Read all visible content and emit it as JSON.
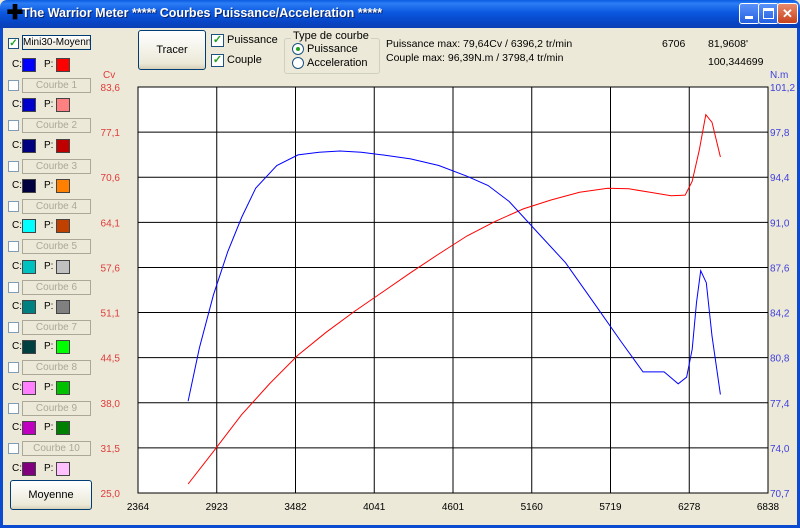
{
  "window": {
    "title": "The Warrior Meter ***** Courbes Puissance/Acceleration *****"
  },
  "sidebar": {
    "top_checked": true,
    "top_button": "Mini30-Moyenne",
    "rows": [
      {
        "label": "Courbe 1",
        "c_color": "#0000ff",
        "p_color": "#ff0000"
      },
      {
        "label": "Courbe 2",
        "c_color": "#0000cd",
        "p_color": "#ff8080"
      },
      {
        "label": "Courbe 3",
        "c_color": "#000080",
        "p_color": "#c00000"
      },
      {
        "label": "Courbe 4",
        "c_color": "#000040",
        "p_color": "#ff8000"
      },
      {
        "label": "Courbe 5",
        "c_color": "#00ffff",
        "p_color": "#c04000"
      },
      {
        "label": "Courbe 6",
        "c_color": "#00c0c0",
        "p_color": "#c0c0c0"
      },
      {
        "label": "Courbe 7",
        "c_color": "#008080",
        "p_color": "#808080"
      },
      {
        "label": "Courbe 8",
        "c_color": "#004040",
        "p_color": "#00ff00"
      },
      {
        "label": "Courbe 9",
        "c_color": "#ff80ff",
        "p_color": "#00c000"
      },
      {
        "label": "Courbe 10",
        "c_color": "#c000c0",
        "p_color": "#008000"
      },
      {
        "label": "",
        "c_color": "#800080",
        "p_color": "#ffc0ff"
      }
    ],
    "c_label": "C:",
    "p_label": "P:",
    "moyenne_button": "Moyenne"
  },
  "toolbar": {
    "tracer_button": "Tracer",
    "puissance_label": "Puissance",
    "puissance_checked": true,
    "couple_label": "Couple",
    "couple_checked": true,
    "type_group_title": "Type de courbe",
    "radio_puissance": "Puissance",
    "radio_acceleration": "Acceleration",
    "selected_type": "Puissance"
  },
  "info": {
    "puissance_max": "Puissance max: 79,64Cv / 6396,2 tr/min",
    "couple_max": "Couple max: 96,39N.m / 3798,4 tr/min",
    "value_1": "6706",
    "value_2": "81,9608'",
    "value_3": "100,344699"
  },
  "chart_data": {
    "type": "line",
    "left_unit": "Cv",
    "right_unit": "N.m",
    "x_ticks": [
      "2364",
      "2923",
      "3482",
      "4041",
      "4601",
      "5160",
      "5719",
      "6278",
      "6838"
    ],
    "xlim": [
      2364,
      6838
    ],
    "left_ticks": [
      "83,6",
      "77,1",
      "70,6",
      "64,1",
      "57,6",
      "51,1",
      "44,5",
      "38,0",
      "31,5",
      "25,0"
    ],
    "left_ylim": [
      25.0,
      83.6
    ],
    "right_ticks": [
      "101,2",
      "97,8",
      "94,4",
      "91,0",
      "87,6",
      "84,2",
      "80,8",
      "77,4",
      "74,0",
      "70,7"
    ],
    "right_ylim": [
      70.7,
      101.2
    ],
    "grid": true,
    "colors": {
      "puissance": "#ff0000",
      "couple": "#0000ff",
      "left_axis": "#e03b3b",
      "right_axis": "#3f3fe0"
    },
    "series": [
      {
        "axis": "left",
        "x": [
          2720,
          2900,
          3100,
          3300,
          3500,
          3700,
          3900,
          4100,
          4300,
          4500,
          4700,
          4900,
          5100,
          5300,
          5500,
          5700,
          5850,
          6000,
          6150,
          6250,
          6300,
          6350,
          6396,
          6440,
          6500
        ],
        "y": [
          26.3,
          31.0,
          36.3,
          40.8,
          44.9,
          48.2,
          51.2,
          54.0,
          56.8,
          59.5,
          62.1,
          64.2,
          66.0,
          67.3,
          68.4,
          69.0,
          68.9,
          68.4,
          67.9,
          68.0,
          70.0,
          74.5,
          79.6,
          78.5,
          73.5
        ]
      },
      {
        "axis": "right",
        "x": [
          2720,
          2800,
          2900,
          3000,
          3100,
          3200,
          3350,
          3500,
          3650,
          3798,
          3950,
          4100,
          4300,
          4500,
          4700,
          4850,
          5000,
          5200,
          5400,
          5600,
          5800,
          5950,
          6100,
          6200,
          6260,
          6300,
          6330,
          6360,
          6400,
          6440,
          6500
        ],
        "y": [
          77.6,
          81.6,
          85.6,
          88.8,
          91.4,
          93.6,
          95.3,
          96.1,
          96.3,
          96.39,
          96.3,
          96.1,
          95.8,
          95.3,
          94.5,
          93.8,
          92.6,
          90.3,
          88.0,
          85.0,
          82.0,
          79.8,
          79.8,
          78.9,
          79.4,
          81.5,
          85.0,
          87.4,
          86.5,
          82.5,
          78.1
        ]
      }
    ]
  }
}
